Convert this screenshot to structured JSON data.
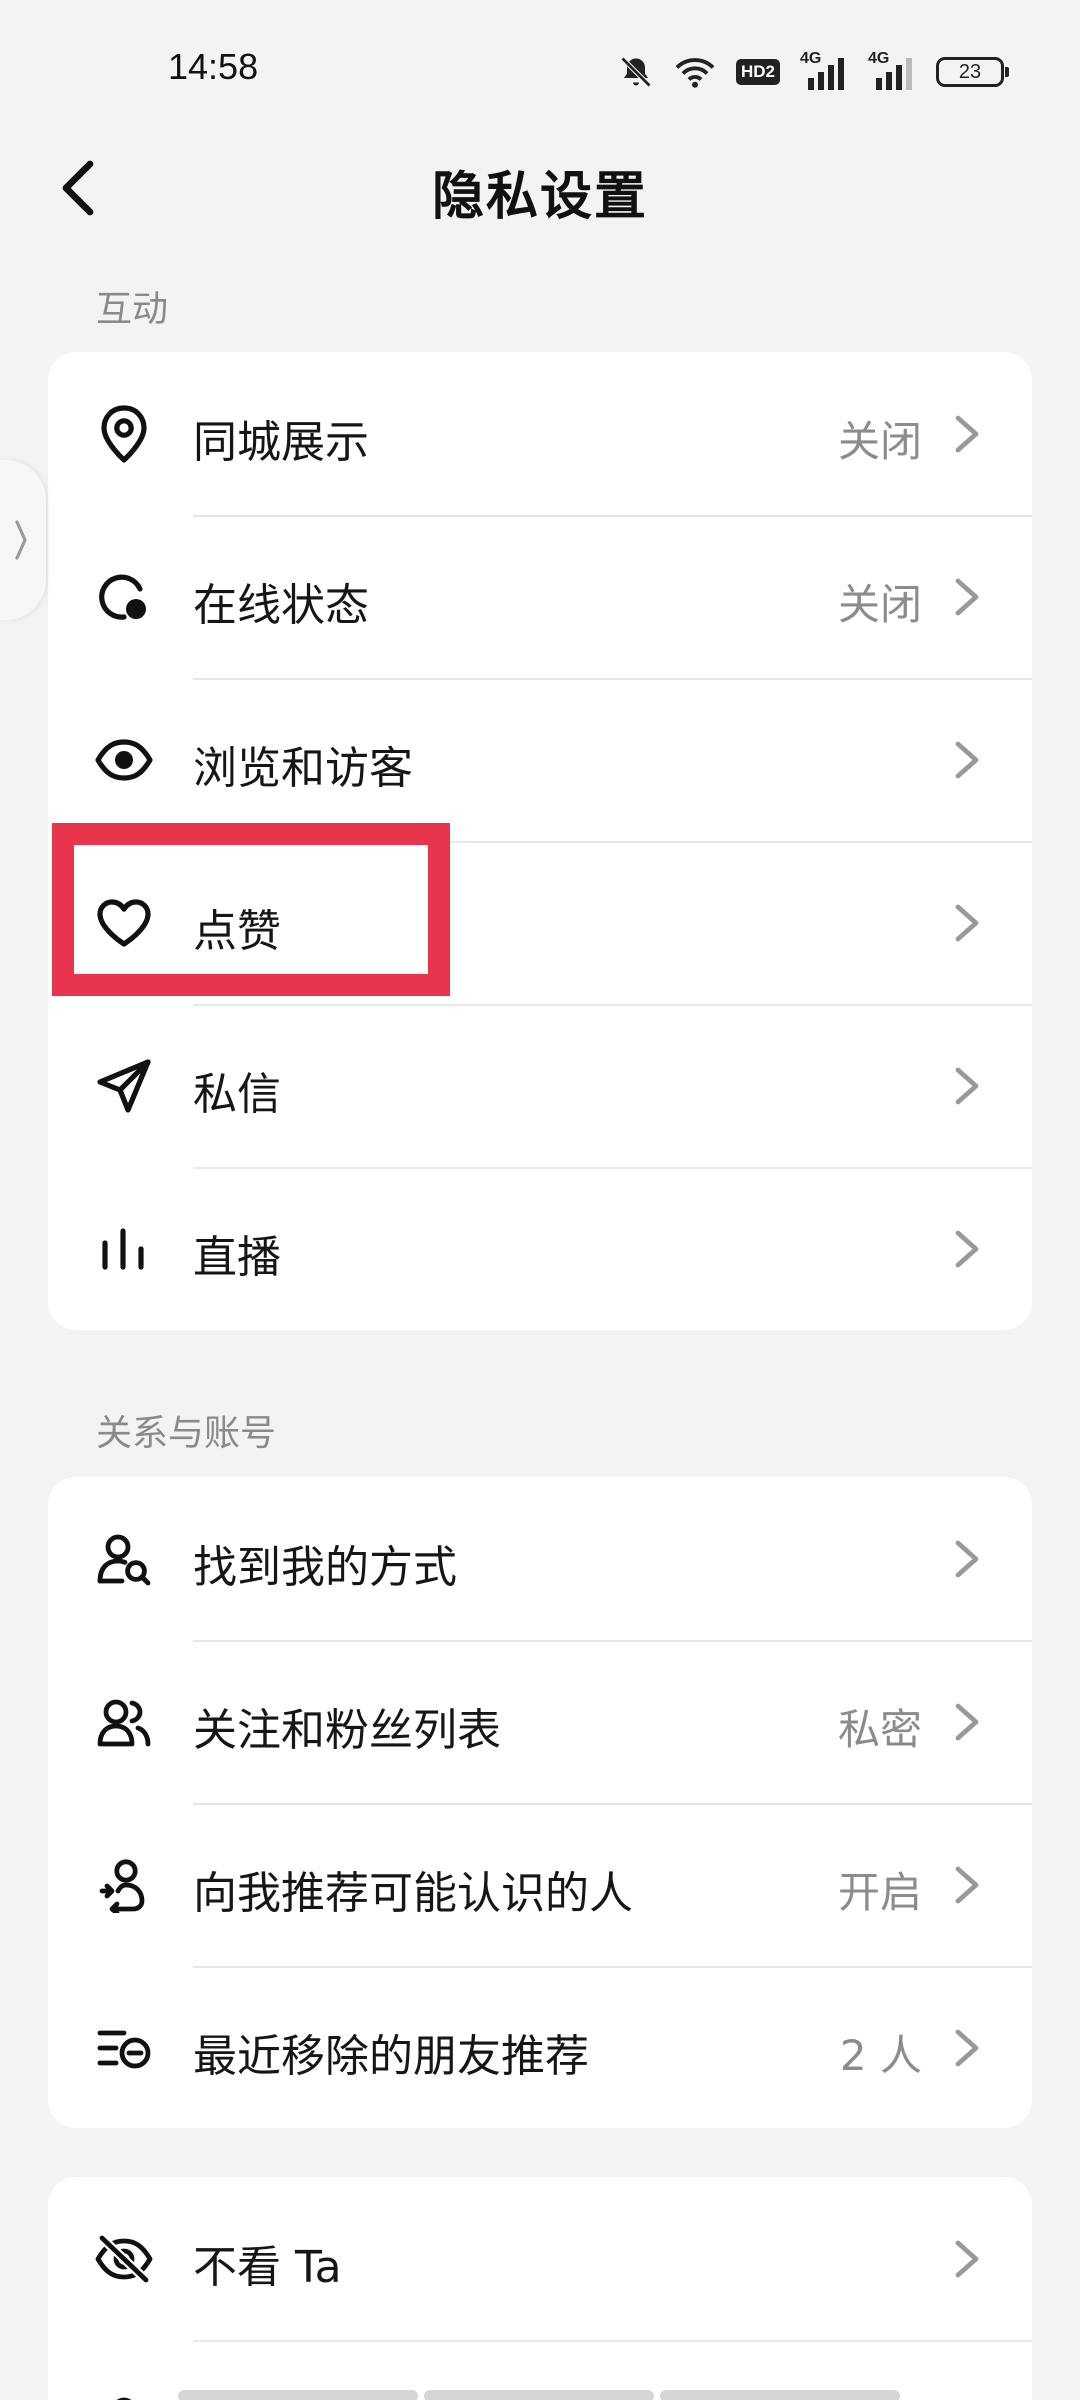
{
  "status_bar": {
    "time": "14:58",
    "hd_label": "HD2",
    "network_1": "4G",
    "network_2": "4G",
    "battery": "23"
  },
  "header": {
    "title": "隐私设置"
  },
  "sections": {
    "interaction": {
      "label": "互动",
      "items": [
        {
          "label": "同城展示",
          "value": "关闭",
          "icon": "location-pin-icon"
        },
        {
          "label": "在线状态",
          "value": "关闭",
          "icon": "online-status-icon"
        },
        {
          "label": "浏览和访客",
          "value": "",
          "icon": "eye-icon"
        },
        {
          "label": "点赞",
          "value": "",
          "icon": "heart-icon"
        },
        {
          "label": "私信",
          "value": "",
          "icon": "send-icon"
        },
        {
          "label": "直播",
          "value": "",
          "icon": "live-bars-icon"
        }
      ]
    },
    "relations": {
      "label": "关系与账号",
      "items": [
        {
          "label": "找到我的方式",
          "value": "",
          "icon": "user-search-icon"
        },
        {
          "label": "关注和粉丝列表",
          "value": "私密",
          "icon": "users-icon"
        },
        {
          "label": "向我推荐可能认识的人",
          "value": "开启",
          "icon": "user-recommend-icon"
        },
        {
          "label": "最近移除的朋友推荐",
          "value": "2 人",
          "icon": "removed-list-icon"
        }
      ]
    },
    "other": {
      "items": [
        {
          "label": "不看 Ta",
          "value": "",
          "icon": "eye-off-icon"
        }
      ]
    }
  },
  "colors": {
    "background": "#f3f3f3",
    "card": "#ffffff",
    "highlight": "#e8344c",
    "secondary_text": "#8c8c8c"
  }
}
